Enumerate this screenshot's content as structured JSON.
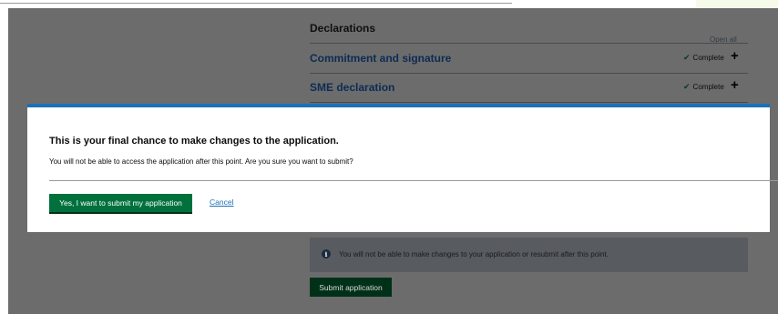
{
  "declarations": {
    "title": "Declarations",
    "open_all": "Open all",
    "items": [
      {
        "label": "Commitment and signature",
        "status": "Complete"
      },
      {
        "label": "SME declaration",
        "status": "Complete"
      }
    ]
  },
  "dialog": {
    "heading": "This is your final chance to make changes to the application.",
    "text": "You will not be able to access the application after this point. Are you sure you want to submit?",
    "confirm_label": "Yes, I want to submit my application",
    "cancel_label": "Cancel"
  },
  "notice": {
    "icon": "info-icon",
    "text": "You will not be able to make changes to your application or resubmit after this point."
  },
  "submit_label": "Submit application",
  "colors": {
    "primary_green": "#00703c",
    "link_blue": "#1d70b8",
    "overlay_gray": "#6c6c6c"
  }
}
